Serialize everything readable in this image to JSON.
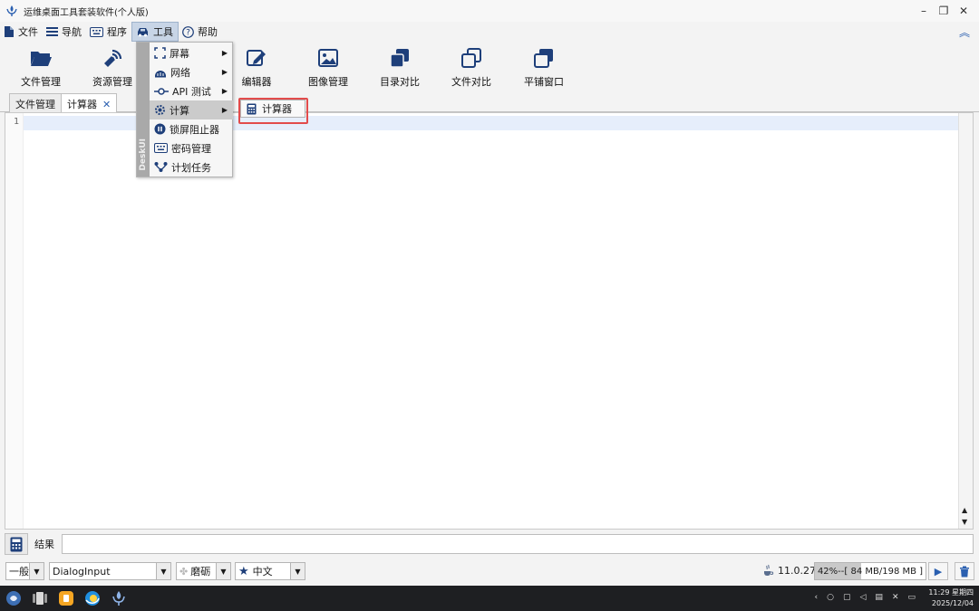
{
  "window": {
    "title": "运维桌面工具套装软件(个人版)",
    "controls": {
      "minimize": "–",
      "restore": "❐",
      "close": "✕"
    }
  },
  "menubar": {
    "items": [
      {
        "label": "文件",
        "icon": "file-icon"
      },
      {
        "label": "导航",
        "icon": "menu-lines-icon"
      },
      {
        "label": "程序",
        "icon": "keyboard-icon"
      },
      {
        "label": "工具",
        "icon": "car-icon",
        "active": true
      },
      {
        "label": "帮助",
        "icon": "help-circle-icon"
      }
    ],
    "collapse_glyph": "︽"
  },
  "toolbar": {
    "items": [
      {
        "label": "文件管理",
        "icon": "folder-open-icon"
      },
      {
        "label": "资源管理",
        "icon": "satellite-icon"
      },
      {
        "label": "编辑器",
        "icon": "edit-icon"
      },
      {
        "label": "图像管理",
        "icon": "image-icon"
      },
      {
        "label": "目录对比",
        "icon": "layers-icon"
      },
      {
        "label": "文件对比",
        "icon": "copy-icon"
      },
      {
        "label": "平铺窗口",
        "icon": "tile-window-icon"
      }
    ]
  },
  "tabs": [
    {
      "label": "文件管理",
      "active": false
    },
    {
      "label": "计算器",
      "active": true,
      "close": "✕"
    }
  ],
  "editor": {
    "line_numbers": [
      "1"
    ]
  },
  "dropdown": {
    "side_label": "DeskUI",
    "items": [
      {
        "label": "屏幕",
        "icon": "screen-frame-icon",
        "submenu": true
      },
      {
        "label": "网络",
        "icon": "network-icon",
        "submenu": true
      },
      {
        "label": "API 测试",
        "icon": "api-node-icon",
        "submenu": true
      },
      {
        "label": "计算",
        "icon": "gear-icon",
        "submenu": true,
        "highlighted": true
      },
      {
        "label": "锁屏阻止器",
        "icon": "pause-circle-icon",
        "submenu": false
      },
      {
        "label": "密码管理",
        "icon": "keyboard-icon",
        "submenu": false
      },
      {
        "label": "计划任务",
        "icon": "schedule-icon",
        "submenu": false
      }
    ],
    "submenu_arrow": "▶"
  },
  "submenu": {
    "item": "计算器",
    "icon": "calculator-icon"
  },
  "result": {
    "label": "结果",
    "value": ""
  },
  "statusbar": {
    "level_select": "一般",
    "font_select": "DialogInput",
    "theme_select": "磨砺",
    "lang_select": "中文",
    "java_version": "11.0.27",
    "memory_text": "42%--[ 84 MB/198 MB ]",
    "memory_fraction": 0.42
  },
  "taskbar": {
    "clock_time": "11:29 星期四",
    "clock_date": "2025/12/04"
  },
  "colors": {
    "accent": "#2a5fb0",
    "highlight_box": "#e24b4b",
    "taskbar": "#1e1f22"
  }
}
